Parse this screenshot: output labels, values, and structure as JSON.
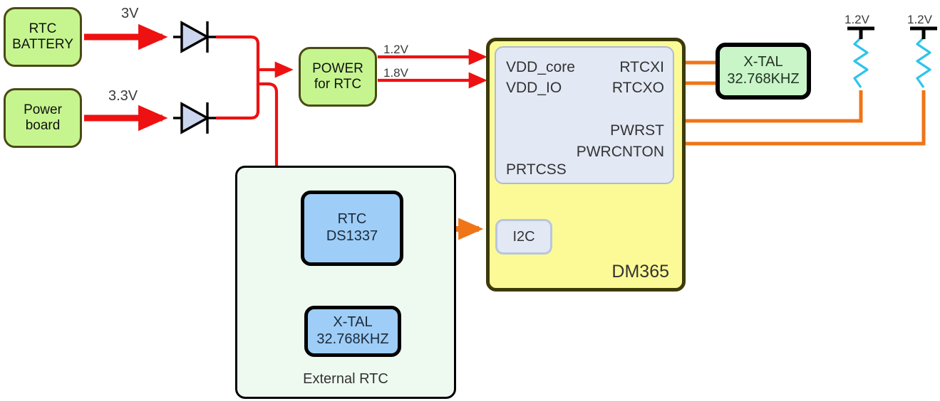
{
  "diagram": {
    "title": "DM365 RTC power and clock block diagram",
    "colors": {
      "source_block_fill": "#c6f590",
      "source_block_border": "#4a4a14",
      "chip_fill": "#fcfa96",
      "chip_border": "#3d3a0a",
      "prtcss_fill": "#e2e8f4",
      "blue_block_fill": "#9ecdf7",
      "xtal_fill": "#c9f5c9",
      "container_fill": "#eefaf0",
      "power_wire": "#ee1111",
      "signal_wire": "#ef7518",
      "resistor": "#2ec4ea"
    }
  },
  "blocks": {
    "rtc_battery": {
      "line1": "RTC",
      "line2": "BATTERY"
    },
    "power_board": {
      "line1": "Power",
      "line2": "board"
    },
    "power_for_rtc": {
      "line1": "POWER",
      "line2": "for RTC"
    },
    "external_rtc_group": {
      "label": "External RTC"
    },
    "rtc_ds1337": {
      "line1": "RTC",
      "line2": "DS1337"
    },
    "xtal_external": {
      "line1": "X-TAL",
      "line2": "32.768KHZ"
    },
    "xtal_dm365": {
      "line1": "X-TAL",
      "line2": "32.768KHZ"
    },
    "dm365": {
      "label": "DM365",
      "prtcss_label": "PRTCSS",
      "i2c_label": "I2C",
      "pins_left": [
        "VDD_core",
        "VDD_IO"
      ],
      "pins_right": [
        "RTCXI",
        "RTCXO",
        "PWRST",
        "PWRCNTON"
      ]
    }
  },
  "wire_labels": {
    "battery_voltage": "3V",
    "board_voltage": "3.3V",
    "core_voltage": "1.2V",
    "io_voltage": "1.8V",
    "pullup_pwrst": "1.2V",
    "pullup_pwrcnton": "1.2V"
  }
}
